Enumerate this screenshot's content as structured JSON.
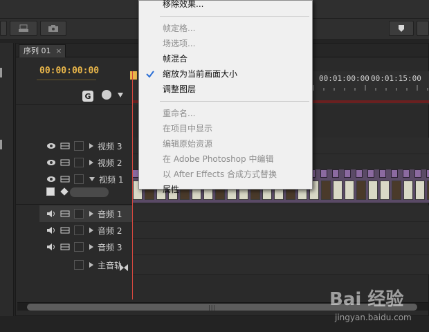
{
  "sequence": {
    "tab_label": "序列 01",
    "tab_close": "×",
    "timecode": "00:00:00:00",
    "ruler": [
      "00:01:00:00",
      "00:01:15:00"
    ],
    "snap_icon": "G"
  },
  "tracks": {
    "video": [
      {
        "label": "视频 3"
      },
      {
        "label": "视频 2"
      },
      {
        "label": "视频 1"
      }
    ],
    "audio": [
      {
        "label": "音频 1"
      },
      {
        "label": "音频 2"
      },
      {
        "label": "音频 3"
      }
    ],
    "master": {
      "label": "主音轨"
    }
  },
  "context_menu": {
    "items": [
      {
        "label": "移除效果...",
        "enabled": true
      },
      {
        "separator": true
      },
      {
        "label": "帧定格...",
        "enabled": false
      },
      {
        "label": "场选项...",
        "enabled": false
      },
      {
        "label": "帧混合",
        "enabled": true
      },
      {
        "label": "缩放为当前画面大小",
        "enabled": true,
        "checked": true
      },
      {
        "label": "调整图层",
        "enabled": true
      },
      {
        "separator": true
      },
      {
        "label": "重命名...",
        "enabled": false
      },
      {
        "label": "在项目中显示",
        "enabled": false
      },
      {
        "label": "编辑原始资源",
        "enabled": false
      },
      {
        "label": "在 Adobe Photoshop 中编辑",
        "enabled": false
      },
      {
        "label": "以 After Effects 合成方式替换",
        "enabled": false
      },
      {
        "label": "属性",
        "enabled": true
      }
    ]
  },
  "watermark": {
    "logo": "Bai 经验",
    "url": "jingyan.baidu.com"
  },
  "colors": {
    "timecode": "#e9b64a",
    "playhead": "#d3473e",
    "clip": "#8b6aa0",
    "check": "#2b6fd6"
  }
}
